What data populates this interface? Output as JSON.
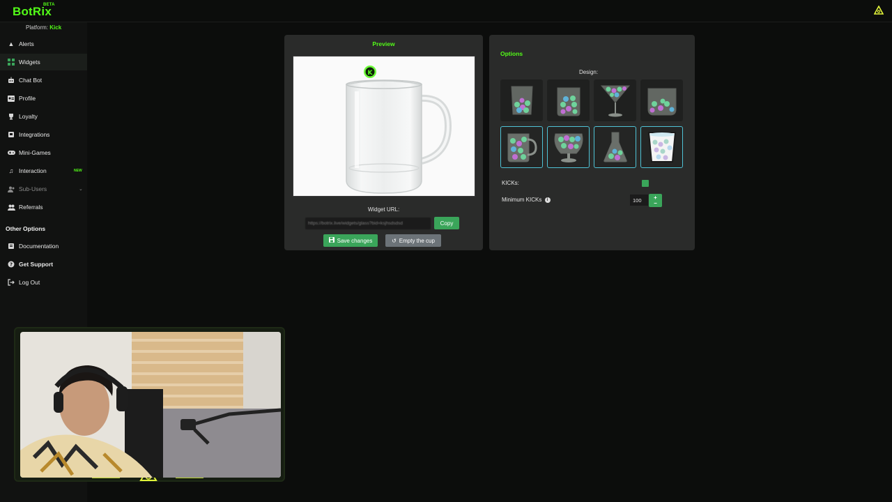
{
  "app": {
    "logo": "BotRix",
    "beta": "BETA"
  },
  "sidebar": {
    "platform_prefix": "Platform:",
    "platform_value": "Kick",
    "items": [
      {
        "label": "Alerts",
        "icon": "warning-icon"
      },
      {
        "label": "Widgets",
        "icon": "grid-icon"
      },
      {
        "label": "Chat Bot",
        "icon": "robot-icon"
      },
      {
        "label": "Profile",
        "icon": "id-card-icon"
      },
      {
        "label": "Loyalty",
        "icon": "trophy-icon"
      },
      {
        "label": "Integrations",
        "icon": "plug-icon"
      },
      {
        "label": "Mini-Games",
        "icon": "gamepad-icon"
      },
      {
        "label": "Interaction",
        "icon": "music-icon",
        "badge": "NEW"
      },
      {
        "label": "Sub-Users",
        "icon": "users-icon"
      },
      {
        "label": "Referrals",
        "icon": "people-icon"
      }
    ],
    "other_title": "Other Options",
    "other_items": [
      {
        "label": "Documentation",
        "icon": "book-icon"
      },
      {
        "label": "Get Support",
        "icon": "question-icon"
      },
      {
        "label": "Log Out",
        "icon": "logout-icon"
      }
    ]
  },
  "preview": {
    "title": "Preview",
    "widget_url_label": "Widget URL:",
    "widget_url_value": "https://botrix.live/widgets/glass?bid=ksjhsdsdsd",
    "copy_label": "Copy",
    "save_label": "Save changes",
    "empty_label": "Empty the cup"
  },
  "options": {
    "title": "Options",
    "design_label": "Design:",
    "kicks_label": "KICKs:",
    "min_kicks_label": "Minimum KICKs",
    "min_kicks_value": "100",
    "designs": [
      "tumbler",
      "jar",
      "martini",
      "bowl",
      "mug",
      "snifter",
      "flask",
      "cup"
    ]
  },
  "colors": {
    "accent": "#53fc18",
    "button": "#3aa55a",
    "selected_border": "#4fc3d6"
  }
}
